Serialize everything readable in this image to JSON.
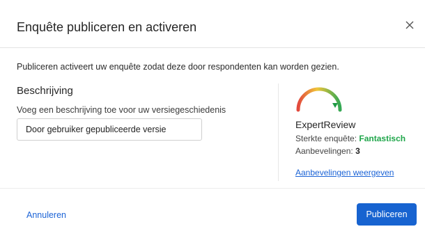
{
  "dialog": {
    "title": "Enquête publiceren en activeren",
    "close_icon": "close-icon"
  },
  "body": {
    "intro": "Publiceren activeert uw enquête zodat deze door respondenten kan worden gezien.",
    "description": {
      "heading": "Beschrijving",
      "label": "Voeg een beschrijving toe voor uw versiegeschiedenis",
      "value": "Door gebruiker gepubliceerde versie"
    },
    "expert_review": {
      "gauge_icon": "quality-gauge-icon",
      "title": "ExpertReview",
      "strength_label": "Sterkte enquête: ",
      "strength_value": "Fantastisch",
      "recommendations_label": "Aanbevelingen: ",
      "recommendations_value": "3",
      "link": "Aanbevelingen weergeven",
      "colors": {
        "strength": "#1fa64a",
        "gauge_red": "#e2483d",
        "gauge_yellow": "#f0c53a",
        "gauge_green": "#34a853"
      }
    }
  },
  "footer": {
    "cancel_label": "Annuleren",
    "publish_label": "Publiceren",
    "accent_color": "#1763d0"
  }
}
